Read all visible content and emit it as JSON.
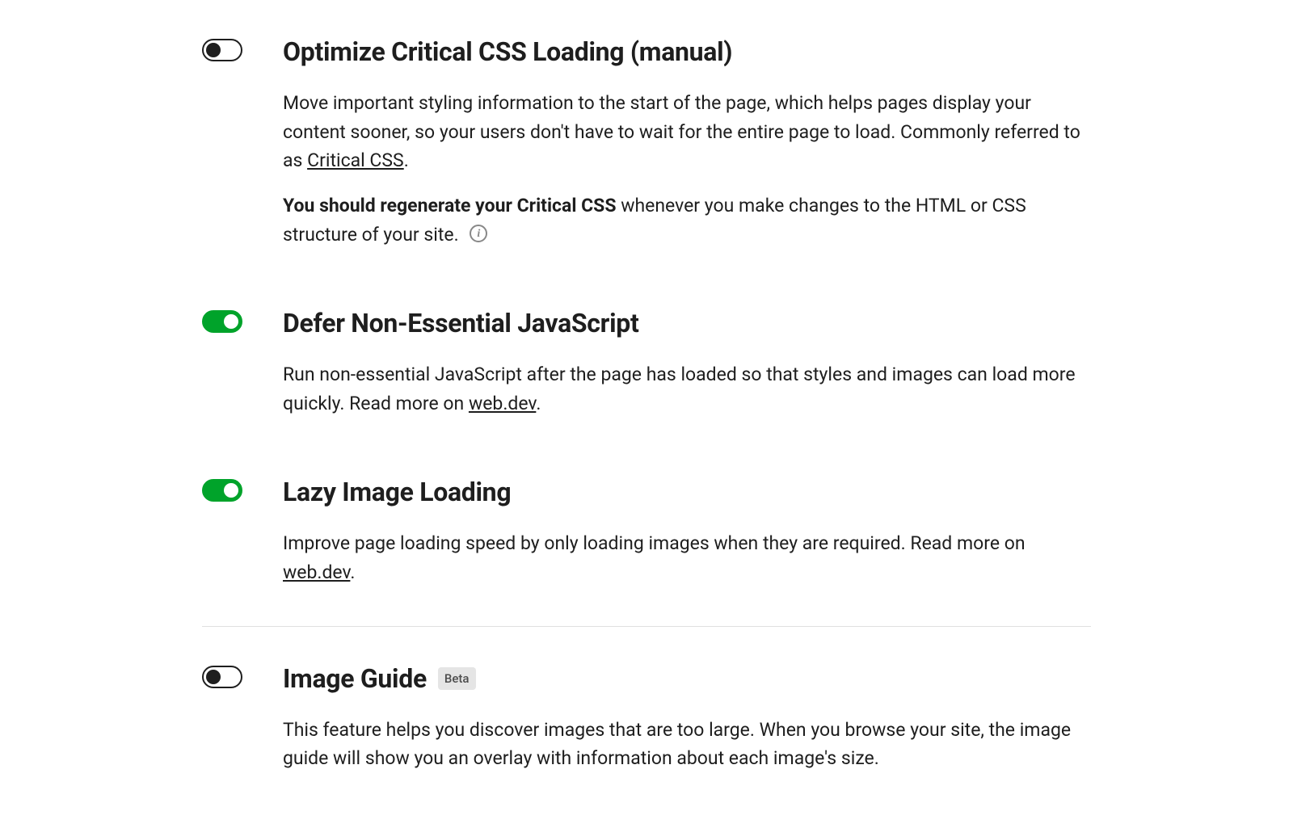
{
  "settings": [
    {
      "key": "optimize-css",
      "enabled": false,
      "title": "Optimize Critical CSS Loading (manual)",
      "desc1_pre": "Move important styling information to the start of the page, which helps pages display your content sooner, so your users don't have to wait for the entire page to load. Commonly referred to as ",
      "desc1_link": "Critical CSS",
      "desc1_post": ".",
      "desc2_bold": "You should regenerate your Critical CSS",
      "desc2_rest": " whenever you make changes to the HTML or CSS structure of your site. ",
      "has_info_icon": true,
      "border_top": false
    },
    {
      "key": "defer-js",
      "enabled": true,
      "title": "Defer Non-Essential JavaScript",
      "desc1_pre": "Run non-essential JavaScript after the page has loaded so that styles and images can load more quickly. Read more on ",
      "desc1_link": "web.dev",
      "desc1_post": ".",
      "border_top": false
    },
    {
      "key": "lazy-image",
      "enabled": true,
      "title": "Lazy Image Loading",
      "desc1_pre": "Improve page loading speed by only loading images when they are required. Read more on ",
      "desc1_link": "web.dev",
      "desc1_post": ".",
      "border_top": false
    },
    {
      "key": "image-guide",
      "enabled": false,
      "title": "Image Guide",
      "badge": "Beta",
      "desc1_pre": "This feature helps you discover images that are too large. When you browse your site, the image guide will show you an overlay with information about each image's size.",
      "border_top": true
    }
  ]
}
